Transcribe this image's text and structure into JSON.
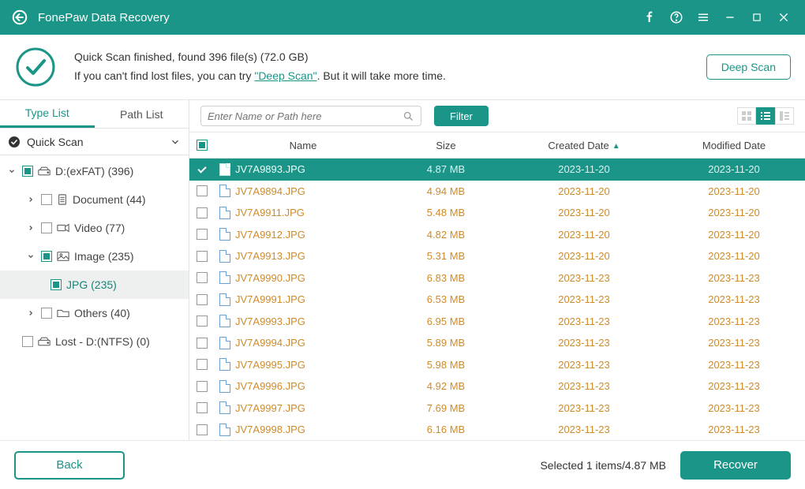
{
  "app": {
    "title": "FonePaw Data Recovery"
  },
  "status": {
    "line1_prefix": "Quick Scan finished, found ",
    "found_count": "396",
    "line1_mid": " file(s) (",
    "found_size": "72.0 GB",
    "line1_suffix": ")",
    "line2_prefix": "If you can't find lost files, you can try ",
    "deep_scan_link": "\"Deep Scan\"",
    "line2_suffix": ". But it will take more time."
  },
  "buttons": {
    "deep_scan": "Deep Scan",
    "filter": "Filter",
    "back": "Back",
    "recover": "Recover"
  },
  "tabs": {
    "type": "Type List",
    "path": "Path List"
  },
  "tree": {
    "quick_scan": "Quick Scan",
    "drive": "D:(exFAT) (396)",
    "document": "Document (44)",
    "video": "Video (77)",
    "image": "Image (235)",
    "jpg": "JPG (235)",
    "others": "Others (40)",
    "lost": "Lost - D:(NTFS) (0)"
  },
  "search": {
    "placeholder": "Enter Name or Path here"
  },
  "columns": {
    "name": "Name",
    "size": "Size",
    "created": "Created Date",
    "modified": "Modified Date"
  },
  "files": [
    {
      "name": "JV7A9893.JPG",
      "size": "4.87 MB",
      "created": "2023-11-20",
      "modified": "2023-11-20",
      "selected": true
    },
    {
      "name": "JV7A9894.JPG",
      "size": "4.94 MB",
      "created": "2023-11-20",
      "modified": "2023-11-20",
      "selected": false
    },
    {
      "name": "JV7A9911.JPG",
      "size": "5.48 MB",
      "created": "2023-11-20",
      "modified": "2023-11-20",
      "selected": false
    },
    {
      "name": "JV7A9912.JPG",
      "size": "4.82 MB",
      "created": "2023-11-20",
      "modified": "2023-11-20",
      "selected": false
    },
    {
      "name": "JV7A9913.JPG",
      "size": "5.31 MB",
      "created": "2023-11-20",
      "modified": "2023-11-20",
      "selected": false
    },
    {
      "name": "JV7A9990.JPG",
      "size": "6.83 MB",
      "created": "2023-11-23",
      "modified": "2023-11-23",
      "selected": false
    },
    {
      "name": "JV7A9991.JPG",
      "size": "6.53 MB",
      "created": "2023-11-23",
      "modified": "2023-11-23",
      "selected": false
    },
    {
      "name": "JV7A9993.JPG",
      "size": "6.95 MB",
      "created": "2023-11-23",
      "modified": "2023-11-23",
      "selected": false
    },
    {
      "name": "JV7A9994.JPG",
      "size": "5.89 MB",
      "created": "2023-11-23",
      "modified": "2023-11-23",
      "selected": false
    },
    {
      "name": "JV7A9995.JPG",
      "size": "5.98 MB",
      "created": "2023-11-23",
      "modified": "2023-11-23",
      "selected": false
    },
    {
      "name": "JV7A9996.JPG",
      "size": "4.92 MB",
      "created": "2023-11-23",
      "modified": "2023-11-23",
      "selected": false
    },
    {
      "name": "JV7A9997.JPG",
      "size": "7.69 MB",
      "created": "2023-11-23",
      "modified": "2023-11-23",
      "selected": false
    },
    {
      "name": "JV7A9998.JPG",
      "size": "6.16 MB",
      "created": "2023-11-23",
      "modified": "2023-11-23",
      "selected": false
    }
  ],
  "footer": {
    "selected_text": "Selected 1 items/4.87 MB"
  },
  "colors": {
    "accent": "#1a9588",
    "amber": "#cf8b2b"
  }
}
